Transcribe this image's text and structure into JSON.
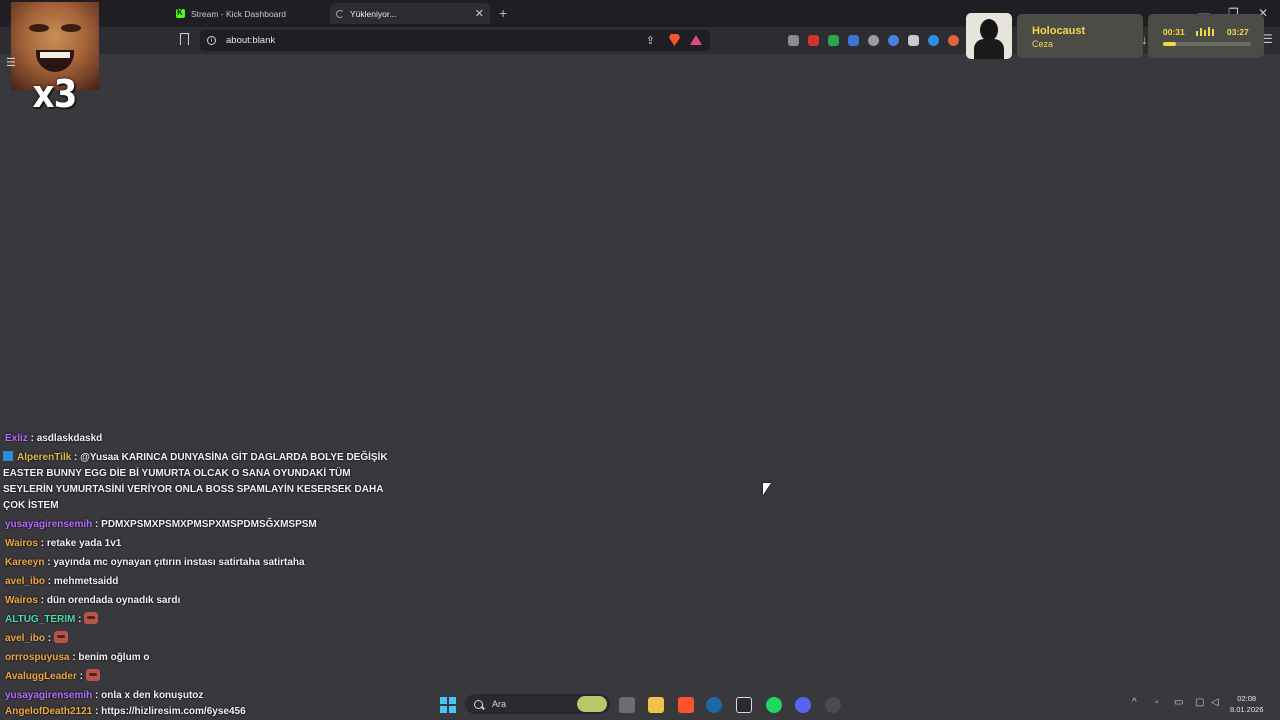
{
  "browser": {
    "tabs": [
      {
        "title": "Stream - Kick Dashboard",
        "active": false
      },
      {
        "title": "Yükleniyor...",
        "active": true
      }
    ],
    "url": "about:blank"
  },
  "overlay": {
    "combo_text": "x3"
  },
  "now_playing": {
    "title": "Holocaust",
    "artist": "Ceza",
    "current_time": "00:31",
    "duration": "03:27",
    "progress": 0.15,
    "accent": "#f4d64d"
  },
  "chat": {
    "messages": [
      {
        "user": "Exliz",
        "color": "#b56bff",
        "text": "asdlaskdaskd"
      },
      {
        "user": "AlperenTilk",
        "color": "#e0b84a",
        "badge": true,
        "text": "@Yusaa KARINCA DUNYASİNA GİT DAGLARDA BOLYE DEĞİŞİK EASTER BUNNY EGG DİE Bİ YUMURTA OLCAK O SANA OYUNDAKİ TÜM SEYLERİN YUMURTASİNİ VERİYOR ONLA BOSS SPAMLAYİN KESERSEK DAHA ÇOK İSTEM"
      },
      {
        "user": "yusayagirensemih",
        "color": "#b56bff",
        "text": "PDMXPSMXPSMXPMSPXMSPDMSĞXMSPSM"
      },
      {
        "user": "Wairos",
        "color": "#f0a640",
        "text": "retake yada 1v1"
      },
      {
        "user": "Kareeyn",
        "color": "#f0a640",
        "text": "yayında mc oynayan çıtırın instası satirtaha satirtaha"
      },
      {
        "user": "avel_ibo",
        "color": "#f0a640",
        "text": "mehmetsaidd"
      },
      {
        "user": "Wairos",
        "color": "#f0a640",
        "text": "dün orendada oynadık sardı"
      },
      {
        "user": "ALTUG_TERIM",
        "color": "#4dd9a8",
        "emote": true,
        "text": ""
      },
      {
        "user": "avel_ibo",
        "color": "#f0a640",
        "emote": true,
        "text": ""
      },
      {
        "user": "orrrospuyusa",
        "color": "#f0a640",
        "text": "benim oğlum o"
      },
      {
        "user": "AvaluggLeader",
        "color": "#f0a640",
        "emote": true,
        "text": ""
      },
      {
        "user": "yusayagirensemih",
        "color": "#b56bff",
        "text": "onla x den konuşutoz"
      }
    ],
    "last": {
      "user": "AngelofDeath2121",
      "color": "#f0a640",
      "text": "https://hizliresim.com/6yse456"
    }
  },
  "taskbar": {
    "search_placeholder": "Ara",
    "time": "02:08",
    "date": "8.01.2026"
  }
}
